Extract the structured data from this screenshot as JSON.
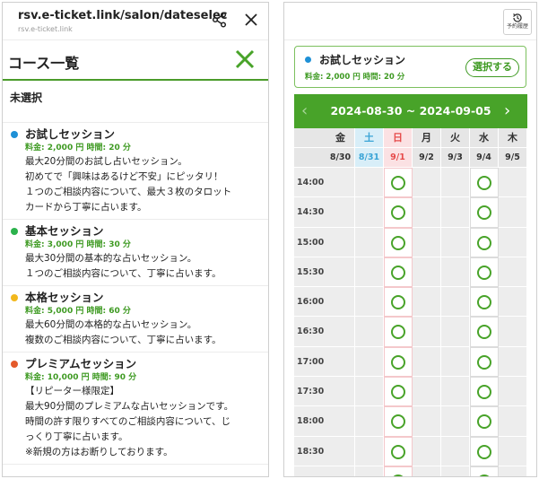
{
  "left": {
    "browser": {
      "url": "rsv.e-ticket.link/salon/dateselec",
      "host": "rsv.e-ticket.link"
    },
    "header": {
      "title": "コース一覧"
    },
    "unselected_label": "未選択",
    "courses": [
      {
        "name": "お試しセッション",
        "dot_color": "#1e90d6",
        "price": "料金: 2,000 円 時間: 20 分",
        "desc": [
          "最大20分間のお試し占いセッション。",
          "初めてで「興味はあるけど不安」にピッタリ！",
          "１つのご相談内容について、最大３枚のタロット",
          "カードから丁寧に占います。"
        ]
      },
      {
        "name": "基本セッション",
        "dot_color": "#2bb24c",
        "price": "料金: 3,000 円 時間: 30 分",
        "desc": [
          "最大30分間の基本的な占いセッション。",
          "１つのご相談内容について、丁寧に占います。"
        ]
      },
      {
        "name": "本格セッション",
        "dot_color": "#f2b81d",
        "price": "料金: 5,000 円 時間: 60 分",
        "desc": [
          "最大60分間の本格的な占いセッション。",
          "複数のご相談内容について、丁寧に占います。"
        ]
      },
      {
        "name": "プレミアムセッション",
        "dot_color": "#e45a2b",
        "price": "料金: 10,000 円 時間: 90 分",
        "desc": [
          "【リピーター様限定】",
          "最大90分間のプレミアムな占いセッションです。",
          "時間の許す限りすべてのご相談内容について、じ",
          "っくり丁寧に占います。",
          "※新規の方はお断りしております。"
        ]
      }
    ]
  },
  "right": {
    "history_label": "予約履歴",
    "selected_course": {
      "name": "お試しセッション",
      "dot_color": "#1e90d6",
      "price": "料金: 2,000 円 時間: 20 分",
      "select_label": "選択する"
    },
    "calendar": {
      "prev": "‹",
      "next": "›",
      "range": "2024-08-30 ~ 2024-09-05",
      "days": [
        {
          "dow": "金",
          "date": "8/30",
          "type": "weekday"
        },
        {
          "dow": "土",
          "date": "8/31",
          "type": "sat"
        },
        {
          "dow": "日",
          "date": "9/1",
          "type": "sun"
        },
        {
          "dow": "月",
          "date": "9/2",
          "type": "weekday"
        },
        {
          "dow": "火",
          "date": "9/3",
          "type": "weekday"
        },
        {
          "dow": "水",
          "date": "9/4",
          "type": "weekday"
        },
        {
          "dow": "木",
          "date": "9/5",
          "type": "weekday"
        }
      ],
      "times": [
        "14:00",
        "14:30",
        "15:00",
        "15:30",
        "16:00",
        "16:30",
        "17:00",
        "17:30",
        "18:00",
        "18:30",
        ""
      ],
      "available_day_indexes": [
        2,
        5
      ],
      "colors": {
        "accent": "#48a329",
        "sat": "#3aa4d6",
        "sun": "#e64a4a"
      }
    }
  }
}
